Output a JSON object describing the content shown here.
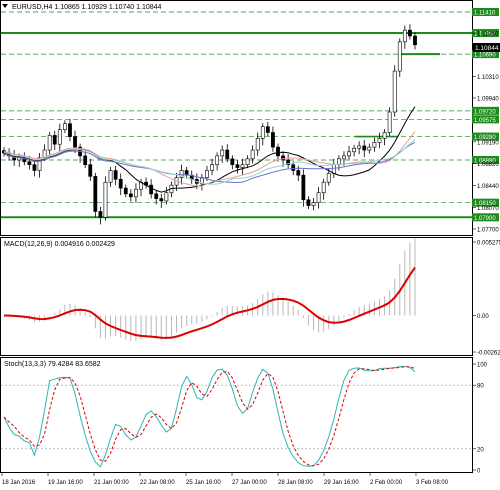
{
  "main": {
    "header": "EURUSD,H4  1.10865 1.10929 1.10740 1.10844",
    "ticks": [
      "1.11050",
      "1.10310",
      "1.09940",
      "1.09190",
      "1.08820",
      "1.08440",
      "1.08070",
      "1.07700"
    ],
    "hlevels": [
      "1.11410",
      "1.11050",
      "1.10690",
      "1.09720",
      "1.09575",
      "1.09280",
      "1.08880",
      "1.08150",
      "1.07900"
    ],
    "price_box": "1.10844"
  },
  "macd": {
    "header": "MACD(12,26,9) 0.004916 0.002429",
    "ticks": [
      "0.005275",
      "0.00",
      "-0.002623"
    ]
  },
  "stoch": {
    "header": "Stoch(13,3,3) 79.4284 83.6582",
    "ticks": [
      "100",
      "80",
      "20",
      "0"
    ]
  },
  "time_axis": [
    "18 Jan 2016",
    "19 Jan 16:00",
    "21 Jan 00:00",
    "22 Jan 08:00",
    "25 Jan 16:00",
    "27 Jan 00:00",
    "28 Jan 08:00",
    "29 Jan 16:00",
    "2 Feb 00:00",
    "3 Feb 08:00"
  ],
  "colors": {
    "green": "#1c8a1c",
    "up_candle": "#ffffff",
    "down_candle": "#000000",
    "macd_signal": "#e00000",
    "stoch_main": "#2fb5b5",
    "stoch_signal": "#e00000",
    "ma_fast": "#e8a0a0",
    "ma_slow": "#6f6fd0"
  }
}
